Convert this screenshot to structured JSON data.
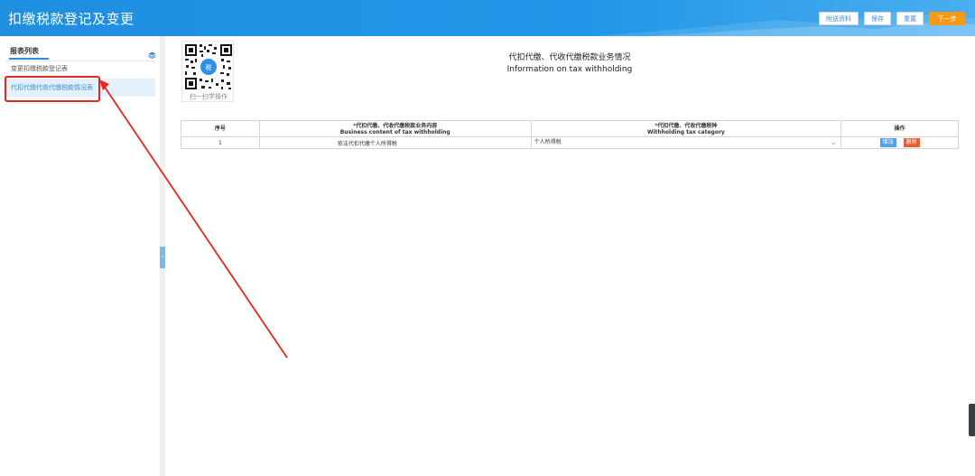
{
  "header": {
    "title": "扣缴税款登记及变更",
    "buttons": {
      "attachments": "附送资料",
      "save": "保存",
      "reset": "重置",
      "next": "下一步"
    }
  },
  "sidebar": {
    "title": "报表列表",
    "items": [
      {
        "label": "变更扣缴税款登记表",
        "active": false
      },
      {
        "label": "代扣代缴代收代缴税款情况表",
        "active": true
      }
    ]
  },
  "qr": {
    "caption": "扫一扫学操作"
  },
  "form": {
    "title_cn": "代扣代缴、代收代缴税款业务情况",
    "title_en": "Information on tax withholding"
  },
  "table": {
    "columns": {
      "index": "序号",
      "business_cn": "代扣代缴、代收代缴税款业务内容",
      "business_en": "Business content of tax withholding",
      "category_cn": "代扣代缴、代收代缴税种",
      "category_en": "Withholding tax category",
      "operation": "操作"
    },
    "rows": [
      {
        "index": "1",
        "business": "依法代扣代缴个人所得税",
        "category": "个人所得税",
        "add_label": "增加",
        "delete_label": "删除"
      }
    ]
  },
  "colors": {
    "header_blue": "#2196e8",
    "next_orange": "#f59a17",
    "add_blue": "#4aa3f0",
    "delete_orange": "#f0592a",
    "annotation_red": "#e8251f"
  }
}
